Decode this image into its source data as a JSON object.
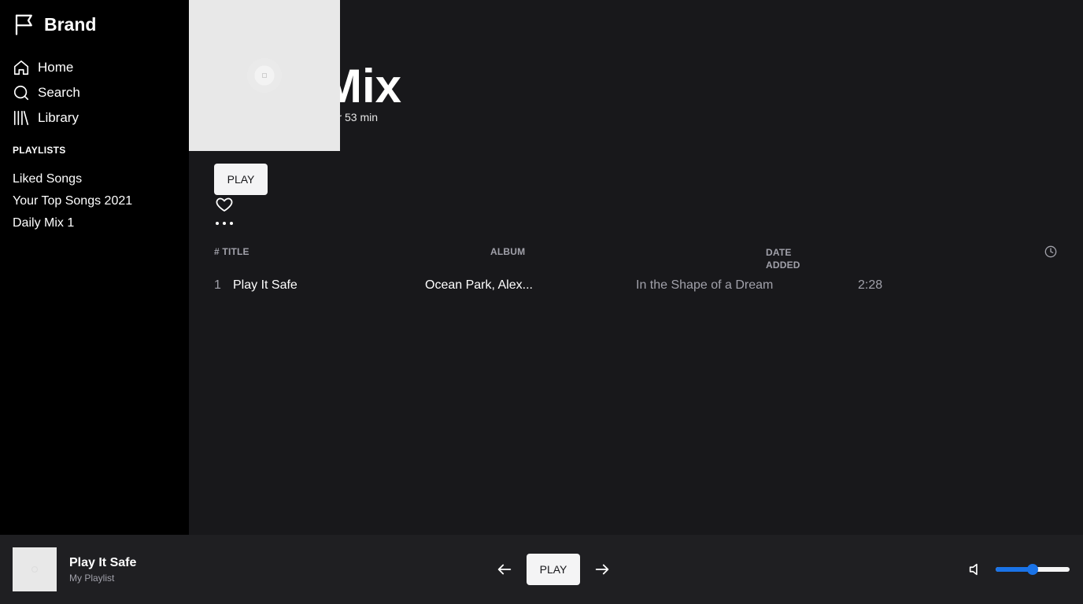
{
  "brand": {
    "name": "Brand"
  },
  "nav": [
    {
      "label": "Home",
      "icon": "home-icon"
    },
    {
      "label": "Search",
      "icon": "search-icon"
    },
    {
      "label": "Library",
      "icon": "library-icon"
    }
  ],
  "sidebar": {
    "playlists_heading": "PLAYLISTS",
    "playlists": [
      "Liked Songs",
      "Your Top Songs 2021",
      "Daily Mix 1"
    ]
  },
  "hero": {
    "title": "Mix",
    "meta": "2 hr 53 min",
    "play_label": "PLAY"
  },
  "table": {
    "headers": {
      "title": "# TITLE",
      "album": "ALBUM",
      "date_added": "DATE\nADDED"
    },
    "rows": [
      {
        "index": "1",
        "title": "Play It Safe",
        "artist": "Ocean Park, Alex...",
        "album": "In the Shape of a Dream",
        "duration": "2:28"
      }
    ]
  },
  "player": {
    "title": "Play It Safe",
    "subtitle": "My Playlist",
    "play_label": "PLAY",
    "volume": 0.5
  },
  "colors": {
    "accent": "#1a73e8",
    "bg": "#18181b",
    "sidebar": "#000000"
  }
}
